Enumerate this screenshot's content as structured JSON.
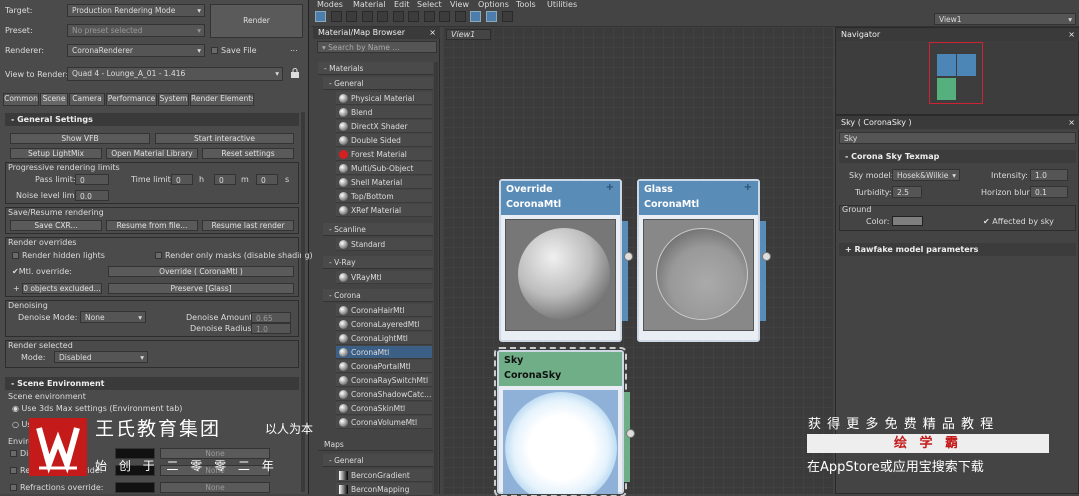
{
  "render_setup": {
    "target_label": "Target:",
    "target_value": "Production Rendering Mode",
    "preset_label": "Preset:",
    "preset_value": "No preset selected",
    "renderer_label": "Renderer:",
    "renderer_value": "CoronaRenderer",
    "save_file_label": "Save File",
    "more_label": "...",
    "view_label": "View to Render:",
    "view_value": "Quad 4 - Lounge_A_01 - 1.416",
    "render_button": "Render",
    "tabs": [
      "Common",
      "Scene",
      "Camera",
      "Performance",
      "System",
      "Render Elements"
    ],
    "general_settings": "General Settings",
    "show_vfb": "Show VFB",
    "start_interactive": "Start interactive",
    "setup_lightmix": "Setup LightMix",
    "open_material_library": "Open Material Library",
    "reset_settings": "Reset settings",
    "progressive_limits": "Progressive rendering limits",
    "pass_limit_label": "Pass limit:",
    "pass_limit": "0",
    "time_limit_label": "Time limit:",
    "time_h": "0",
    "h": "h",
    "time_m": "0",
    "m": "m",
    "time_s": "0",
    "s": "s",
    "noise_label": "Noise level limit:",
    "noise_value": "0.0",
    "save_resume": "Save/Resume rendering",
    "save_cxr": "Save CXR...",
    "resume_file": "Resume from file...",
    "resume_last": "Resume last render",
    "render_overrides": "Render overrides",
    "hidden_lights": "Render hidden lights",
    "only_masks": "Render only masks (disable shading)",
    "mtl_override": "Mtl. override:",
    "override_value": "Override  ( CoronaMtl )",
    "plus": "+",
    "excluded": "0 objects excluded...",
    "preserve": "Preserve [Glass]",
    "denoising": "Denoising",
    "denoise_mode_label": "Denoise Mode:",
    "denoise_mode": "None",
    "denoise_amount_label": "Denoise Amount:",
    "denoise_amount": "0.65",
    "denoise_radius_label": "Denoise Radius:",
    "denoise_radius": "1.0",
    "render_selected": "Render selected",
    "mode_label": "Mode:",
    "mode_value": "Disabled",
    "scene_environment": "Scene Environment",
    "scene_env_sub": "Scene environment",
    "use_3dsmax": "Use 3ds Max settings (Environment tab)",
    "use_partial": "Us",
    "envir_partial": "Enviro",
    "direct_partial": "Dir",
    "reflections_override": "Reflections override:",
    "refractions_override": "Refractions override:",
    "none1": "None",
    "none2": "None",
    "none3": "None"
  },
  "menu": [
    "Modes",
    "Material",
    "Edit",
    "Select",
    "View",
    "Options",
    "Tools",
    "Utilities"
  ],
  "view_dropdown": "View1",
  "browser": {
    "title": "Material/Map Browser",
    "search_placeholder": "Search by Name ...",
    "materials": "- Materials",
    "general": "- General",
    "general_items": [
      "Physical Material",
      "Blend",
      "DirectX Shader",
      "Double Sided",
      "Forest Material",
      "Multi/Sub-Object",
      "Shell Material",
      "Top/Bottom",
      "XRef Material"
    ],
    "scanline": "- Scanline",
    "scanline_items": [
      "Standard"
    ],
    "vray": "- V-Ray",
    "vray_items": [
      "VRayMtl"
    ],
    "corona": "- Corona",
    "corona_items": [
      "CoronaHairMtl",
      "CoronaLayeredMtl",
      "CoronaLightMtl",
      "CoronaMtl",
      "CoronaPortalMtl",
      "CoronaRaySwitchMtl",
      "CoronaShadowCatc...",
      "CoronaSkinMtl",
      "CoronaVolumeMtl"
    ],
    "maps": "Maps",
    "maps_general": "- General",
    "maps_items": [
      "BerconGradient",
      "BerconMapping"
    ]
  },
  "view_tab": "View1",
  "nodes": [
    {
      "title1": "Override",
      "title2": "CoronaMtl"
    },
    {
      "title1": "Glass",
      "title2": "CoronaMtl"
    },
    {
      "title1": "Sky",
      "title2": "CoronaSky"
    }
  ],
  "navigator": "Navigator",
  "sky_panel": {
    "title": "Sky  ( CoronaSky )",
    "name": "Sky",
    "rollout": "Corona Sky Texmap",
    "sky_model_label": "Sky model:",
    "sky_model": "Hosek&Wilkie",
    "intensity_label": "Intensity:",
    "intensity": "1.0",
    "turbidity_label": "Turbidity:",
    "turbidity": "2.5",
    "horizon_label": "Horizon blur:",
    "horizon": "0.1",
    "ground": "Ground",
    "color_label": "Color:",
    "affected": "Affected by sky",
    "rawfake": "Rawfake model parameters"
  },
  "watermark": {
    "company": "王氏教育集团",
    "slogan": "以人为本",
    "founded": "始 创 于 二 零 零 二 年",
    "promo1": "获 得 更 多 免 费 精 品 教 程",
    "brand": "绘 学 霸",
    "promo2": "在AppStore或应用宝搜索下载"
  }
}
